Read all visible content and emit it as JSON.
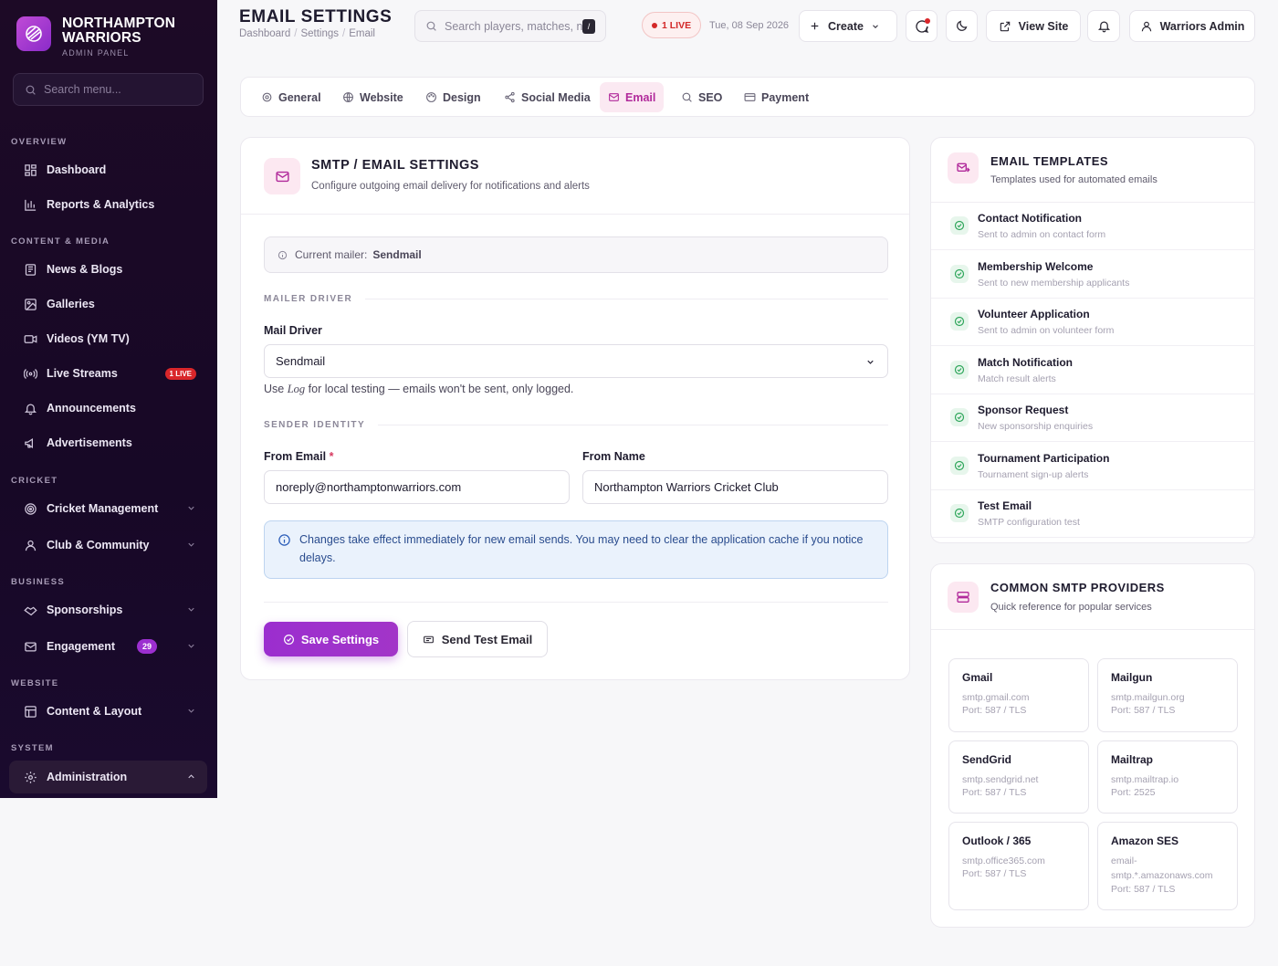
{
  "brand": {
    "name": "NORTHAMPTON WARRIORS",
    "sub": "ADMIN PANEL"
  },
  "sidebar": {
    "search_placeholder": "Search menu...",
    "sections": {
      "overview": "OVERVIEW",
      "content": "CONTENT & MEDIA",
      "cricket": "CRICKET",
      "business": "BUSINESS",
      "website": "WEBSITE",
      "system": "SYSTEM"
    },
    "items": {
      "dashboard": "Dashboard",
      "reports": "Reports & Analytics",
      "news": "News & Blogs",
      "galleries": "Galleries",
      "videos": "Videos (YM TV)",
      "live": "Live Streams",
      "live_badge": "1 LIVE",
      "announcements": "Announcements",
      "ads": "Advertisements",
      "cricket": "Cricket Management",
      "club": "Club & Community",
      "sponsorships": "Sponsorships",
      "engagement": "Engagement",
      "engagement_count": "29",
      "content_layout": "Content & Layout",
      "administration": "Administration"
    }
  },
  "header": {
    "title": "EMAIL SETTINGS",
    "breadcrumb": [
      "Dashboard",
      "Settings",
      "Email"
    ],
    "search_placeholder": "Search players, matches, n",
    "kbd": "/",
    "live": "1 LIVE",
    "date": "Tue, 08 Sep 2026",
    "create": "Create",
    "view_site": "View Site",
    "user": "Warriors Admin"
  },
  "tabs": [
    {
      "label": "General",
      "icon": "gear-icon"
    },
    {
      "label": "Website",
      "icon": "globe-icon"
    },
    {
      "label": "Design",
      "icon": "palette-icon"
    },
    {
      "label": "Social Media",
      "icon": "share-icon"
    },
    {
      "label": "Email",
      "icon": "mail-icon",
      "active": true
    },
    {
      "label": "SEO",
      "icon": "search-icon"
    },
    {
      "label": "Payment",
      "icon": "card-icon"
    }
  ],
  "smtp": {
    "title": "SMTP / EMAIL SETTINGS",
    "subtitle": "Configure outgoing email delivery for notifications and alerts",
    "current_label": "Current mailer:",
    "current_value": "Sendmail",
    "group_driver": "MAILER DRIVER",
    "driver_label": "Mail Driver",
    "driver_value": "Sendmail",
    "help_pre": "Use",
    "help_em": "Log",
    "help_post": "for local testing — emails won't be sent, only logged.",
    "group_sender": "SENDER IDENTITY",
    "from_email_label": "From Email",
    "from_email_req": "*",
    "from_email_value": "noreply@northamptonwarriors.com",
    "from_name_label": "From Name",
    "from_name_value": "Northampton Warriors Cricket Club",
    "notice": "Changes take effect immediately for new email sends. You may need to clear the application cache if you notice delays.",
    "save": "Save Settings",
    "test": "Send Test Email"
  },
  "templates": {
    "title": "EMAIL TEMPLATES",
    "subtitle": "Templates used for automated emails",
    "items": [
      {
        "name": "Contact Notification",
        "desc": "Sent to admin on contact form"
      },
      {
        "name": "Membership Welcome",
        "desc": "Sent to new membership applicants"
      },
      {
        "name": "Volunteer Application",
        "desc": "Sent to admin on volunteer form"
      },
      {
        "name": "Match Notification",
        "desc": "Match result alerts"
      },
      {
        "name": "Sponsor Request",
        "desc": "New sponsorship enquiries"
      },
      {
        "name": "Tournament Participation",
        "desc": "Tournament sign-up alerts"
      },
      {
        "name": "Test Email",
        "desc": "SMTP configuration test"
      }
    ]
  },
  "providers": {
    "title": "COMMON SMTP PROVIDERS",
    "subtitle": "Quick reference for popular services",
    "items": [
      {
        "name": "Gmail",
        "host": "smtp.gmail.com",
        "port": "Port: 587 / TLS"
      },
      {
        "name": "Mailgun",
        "host": "smtp.mailgun.org",
        "port": "Port: 587 / TLS"
      },
      {
        "name": "SendGrid",
        "host": "smtp.sendgrid.net",
        "port": "Port: 587 / TLS"
      },
      {
        "name": "Mailtrap",
        "host": "smtp.mailtrap.io",
        "port": "Port: 2525"
      },
      {
        "name": "Outlook / 365",
        "host": "smtp.office365.com",
        "port": "Port: 587 / TLS"
      },
      {
        "name": "Amazon SES",
        "host": "email-smtp.*.amazonaws.com",
        "port": "Port: 587 / TLS"
      }
    ]
  },
  "colors": {
    "accent": "#9b2ecf",
    "sidebar": "#1d0a26",
    "live": "#d9262a"
  }
}
